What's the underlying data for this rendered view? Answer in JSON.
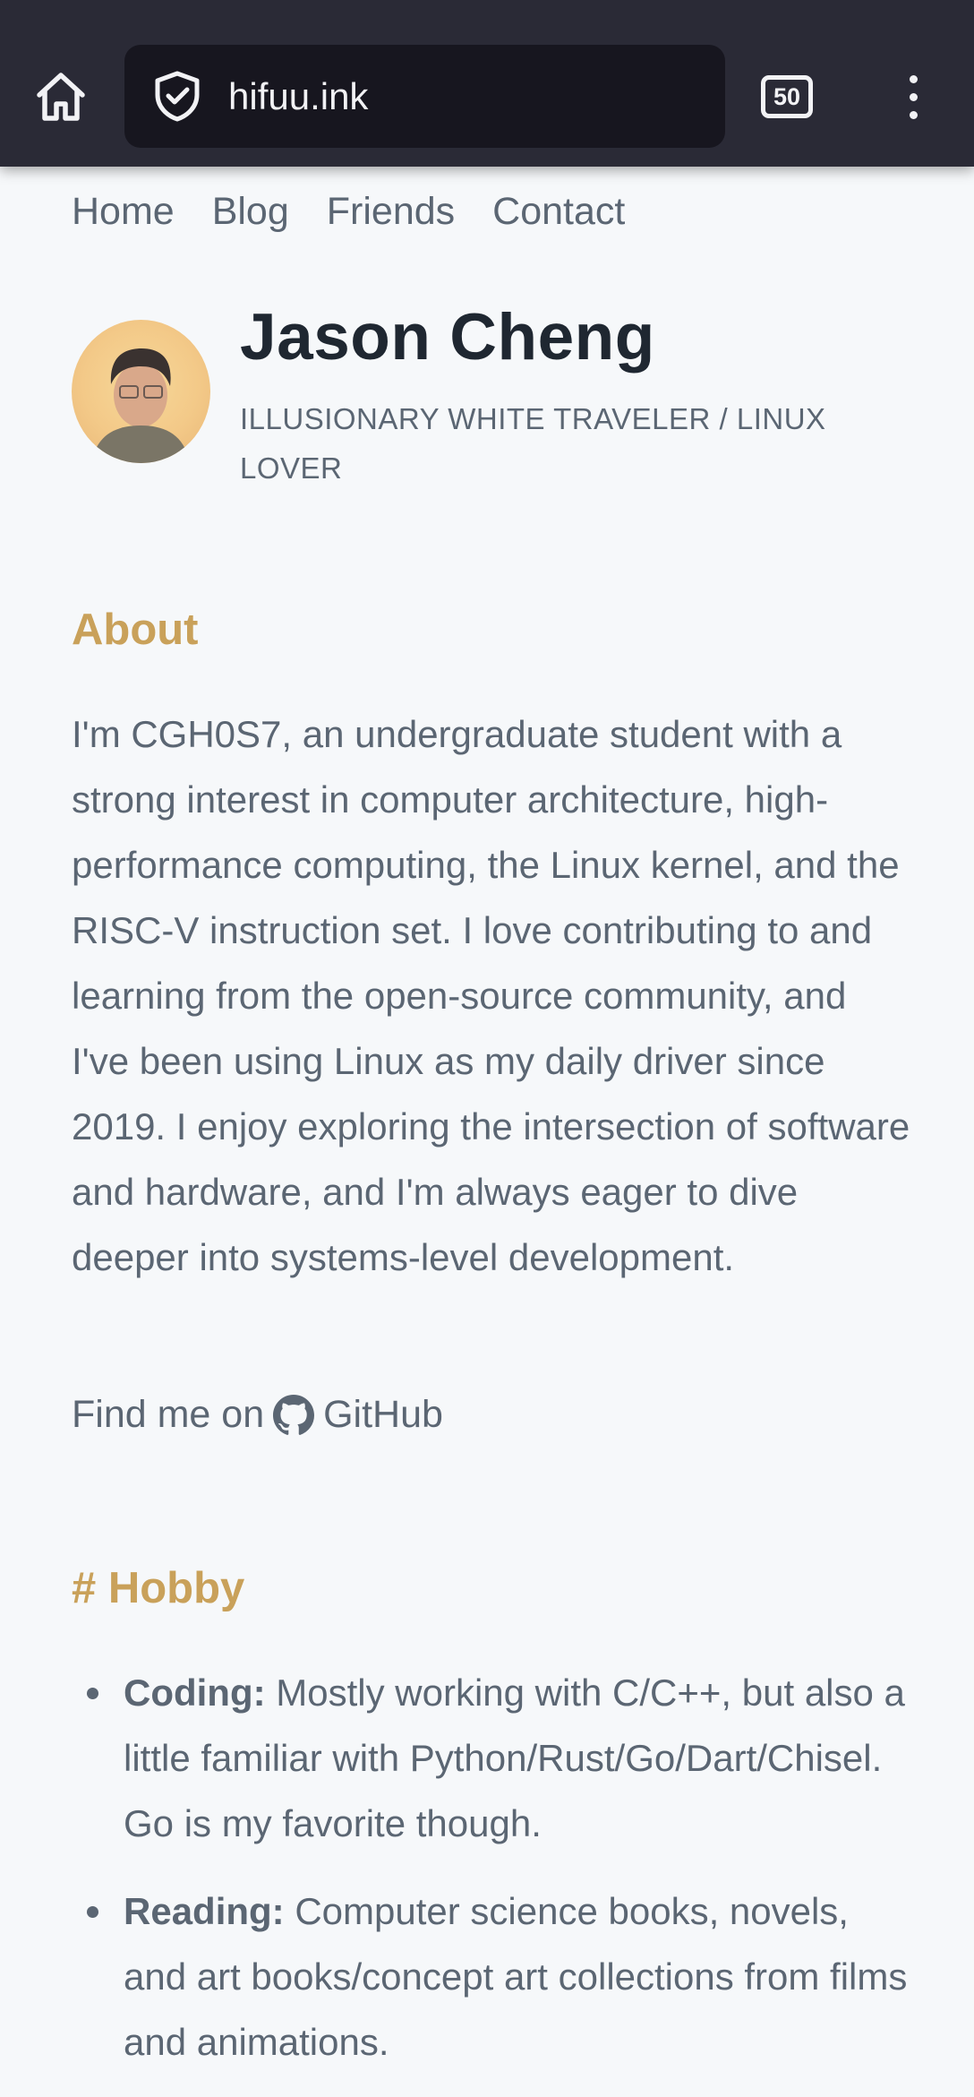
{
  "browser": {
    "url": "hifuu.ink",
    "tab_count": "50",
    "icons": {
      "home": "home-icon",
      "site_security": "shield-check-icon",
      "menu": "kebab-menu-icon"
    }
  },
  "nav": {
    "items": [
      {
        "label": "Home"
      },
      {
        "label": "Blog"
      },
      {
        "label": "Friends"
      },
      {
        "label": "Contact"
      }
    ]
  },
  "profile": {
    "name": "Jason Cheng",
    "tagline": "ILLUSIONARY WHITE TRAVELER / LINUX LOVER"
  },
  "about": {
    "title": "About",
    "body": "I'm CGH0S7, an undergraduate student with a strong interest in computer architecture, high-performance computing, the Linux kernel, and the RISC-V instruction set. I love contributing to and learning from the open-source community, and I've been using Linux as my daily driver since 2019. I enjoy exploring the intersection of software and hardware, and I'm always eager to dive deeper into systems-level development.",
    "find_me_prefix": "Find me on",
    "github_label": "GitHub"
  },
  "hobby": {
    "title": "# Hobby",
    "items": [
      {
        "label": "Coding:",
        "text": " Mostly working with C/C++, but also a little familiar with Python/Rust/Go/Dart/Chisel. Go is my favorite though."
      },
      {
        "label": "Reading:",
        "text": " Computer science books, novels, and art books/concept art collections from films and animations."
      }
    ]
  },
  "colors": {
    "browser_bar": "#2a2a36",
    "page_bg": "#f6f8fa",
    "accent": "#c9a15a",
    "text": "#5b6673",
    "heading": "#1f2731"
  }
}
